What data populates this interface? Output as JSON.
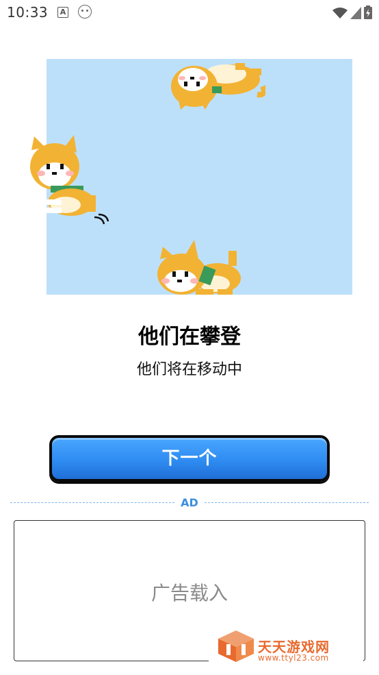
{
  "status_bar": {
    "time": "10:33",
    "a_icon_letter": "A",
    "icons": [
      "a-notification-icon",
      "face-notification-icon",
      "wifi-icon",
      "signal-icon",
      "battery-icon"
    ]
  },
  "scene": {
    "background": "#bde0fa",
    "characters": [
      "shiba-dog",
      "shiba-dog",
      "shiba-dog"
    ]
  },
  "content": {
    "title": "他们在攀登",
    "subtitle": "他们将在移动中"
  },
  "next_button": {
    "label": "下一个",
    "color": "#2f8cf2"
  },
  "ad": {
    "divider_label": "AD",
    "loading_text": "广告载入"
  },
  "watermark": {
    "name": "天天游戏网",
    "url": "www.ttyl23.com",
    "color": "#e86a2e"
  }
}
